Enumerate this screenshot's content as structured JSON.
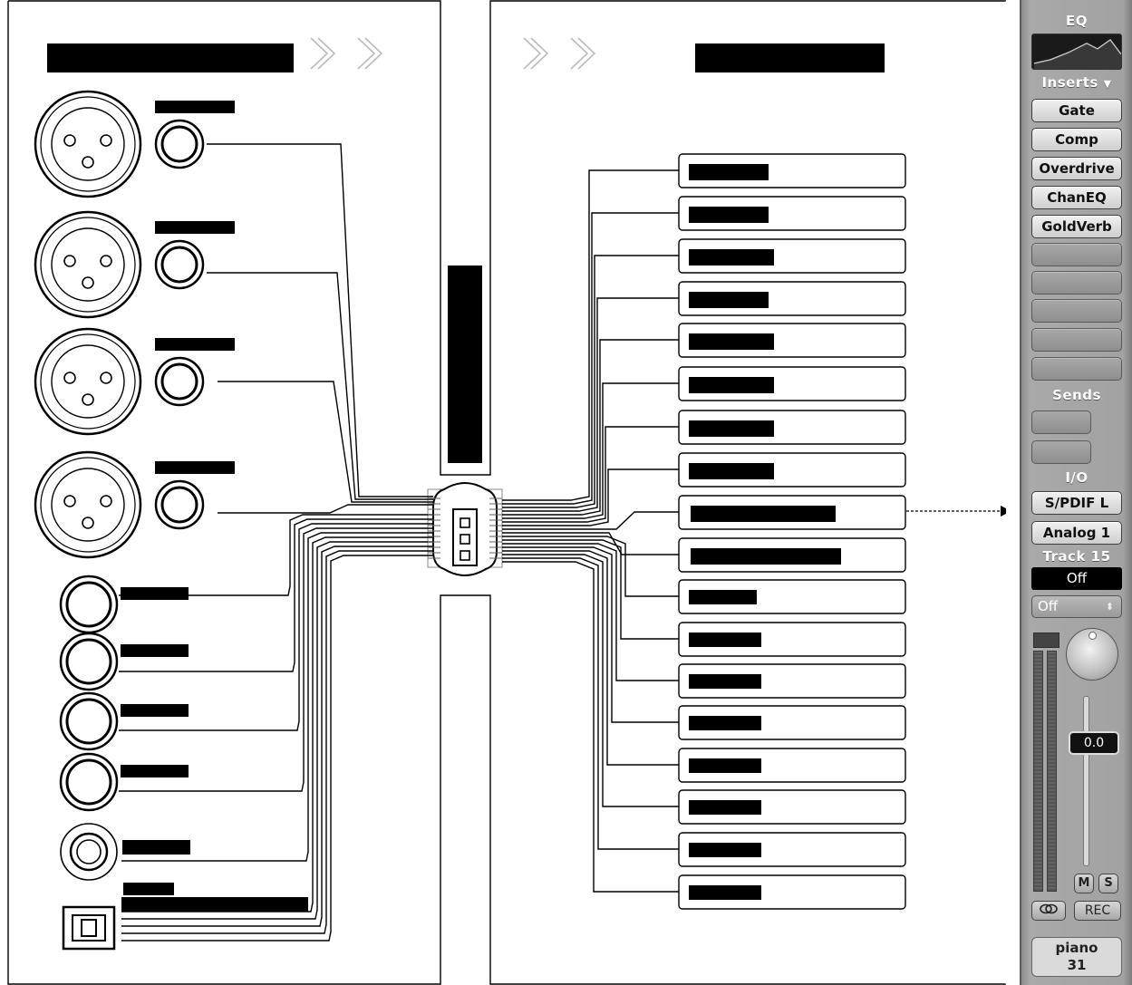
{
  "channel_strip": {
    "eq_label": "EQ",
    "inserts_label": "Inserts",
    "inserts_arrow": "▼",
    "inserts": [
      "Gate",
      "Comp",
      "Overdrive",
      "ChanEQ",
      "GoldVerb"
    ],
    "sends_label": "Sends",
    "io_label": "I/O",
    "input": "S/PDIF L",
    "output": "Analog 1",
    "track_label": "Track 15",
    "automation": "Off",
    "group": "Off",
    "group_arrow": "⬍",
    "fader_value": "0.0",
    "mute_label": "M",
    "solo_label": "S",
    "link_icon": "link-rings-icon",
    "rec_label": "REC",
    "track_name": "piano",
    "track_number": "31"
  }
}
